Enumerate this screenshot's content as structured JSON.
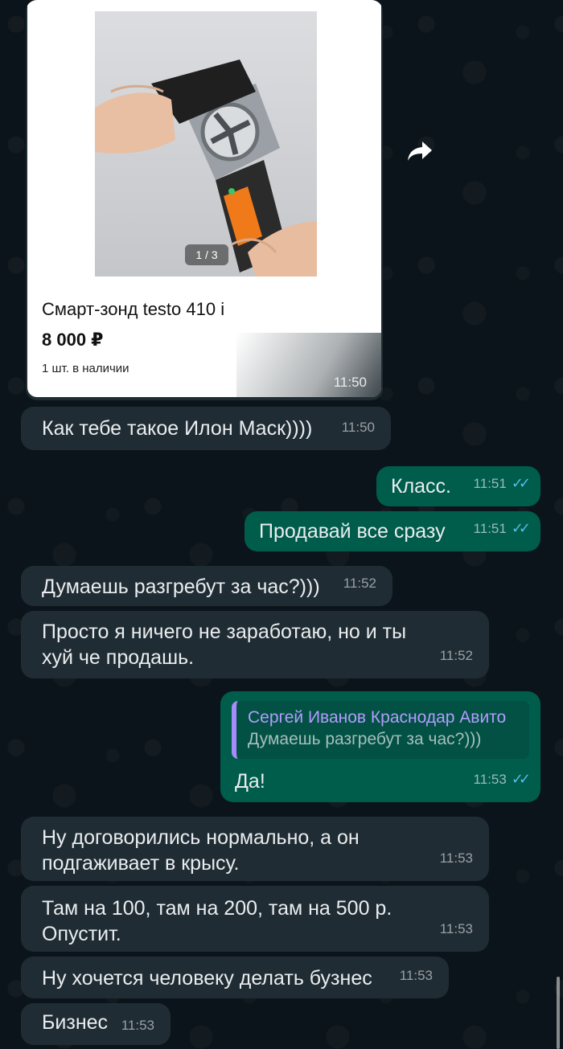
{
  "product": {
    "photo_counter": "1 / 3",
    "title": "Смарт-зонд testo 410 i",
    "price": "8 000 ₽",
    "stock": "1 шт. в наличии",
    "time": "11:50"
  },
  "messages": [
    {
      "text": "Как тебе такое Илон Маск))))",
      "time": "11:50"
    },
    {
      "text": "Класс.",
      "time": "11:51",
      "ticks": "✓✓"
    },
    {
      "text": "Продавай все сразу",
      "time": "11:51",
      "ticks": "✓✓"
    },
    {
      "text": "Думаешь разгребут за час?)))",
      "time": "11:52"
    },
    {
      "text": "Просто я ничего не заработаю, но и ты хуй че продашь.",
      "time": "11:52"
    },
    {
      "quote_name": "Сергей Иванов Краснодар Авито",
      "quote_text": "Думаешь разгребут за час?)))",
      "text": "Да!",
      "time": "11:53",
      "ticks": "✓✓"
    },
    {
      "text": "Ну договорились нормально, а он подгаживает в крысу.",
      "time": "11:53"
    },
    {
      "text": "Там на 100, там на 200, там на 500 р. Опустит.",
      "time": "11:53"
    },
    {
      "text": "Ну хочется человеку делать бузнес",
      "time": "11:53"
    },
    {
      "text": "Бизнес",
      "time": "11:53"
    }
  ],
  "colors": {
    "background": "#0b141a",
    "incoming_bubble": "#202c33",
    "outgoing_bubble": "#005c4b",
    "read_ticks": "#53bdeb",
    "quote_name": "#b39dff"
  }
}
